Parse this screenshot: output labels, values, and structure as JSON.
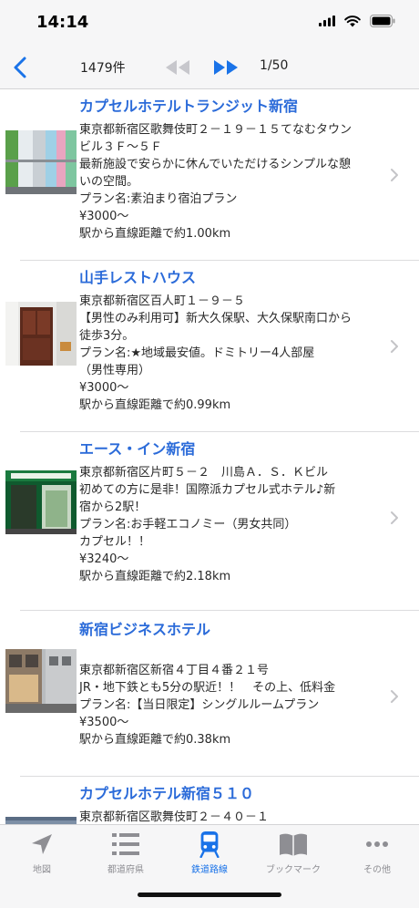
{
  "status": {
    "time": "14:14"
  },
  "nav": {
    "count": "1479件",
    "page": "1/50"
  },
  "hotels": [
    {
      "name": "カプセルホテルトランジット新宿",
      "lines": [
        "東京都新宿区歌舞伎町２－１９－１５てなむタウン",
        "ビル３Ｆ～５Ｆ",
        "最新施設で安らかに休んでいただけるシンプルな憩",
        "いの空間。",
        "プラン名:素泊まり宿泊プラン",
        "¥3000～",
        "駅から直線距離で約1.00km"
      ]
    },
    {
      "name": "山手レストハウス",
      "lines": [
        "東京都新宿区百人町１－９－５",
        "【男性のみ利用可】新大久保駅、大久保駅南口から",
        "徒歩3分。",
        "プラン名:★地域最安値。ドミトリー4人部屋",
        "（男性専用）",
        "¥3000～",
        "駅から直線距離で約0.99km"
      ]
    },
    {
      "name": "エース・イン新宿",
      "lines": [
        "東京都新宿区片町５－２　川島Ａ．Ｓ．Ｋビル",
        "初めての方に是非！国際派カプセル式ホテル♪新",
        "宿から2駅！",
        "プラン名:お手軽エコノミー（男女共同）",
        "カプセル！！",
        "¥3240～",
        "駅から直線距離で約2.18km"
      ]
    },
    {
      "name": "新宿ビジネスホテル",
      "lines": [
        "東京都新宿区新宿４丁目４番２１号",
        "JR・地下鉄とも5分の駅近！！　その上、低料金",
        "プラン名:【当日限定】シングルルームプラン",
        "¥3500～",
        "駅から直線距離で約0.38km"
      ]
    },
    {
      "name": "カプセルホテル新宿５１０",
      "lines": [
        "東京都新宿区歌舞伎町２－４０－１"
      ]
    }
  ],
  "tabs": [
    {
      "label": "地図",
      "icon": "location-arrow-icon",
      "active": false
    },
    {
      "label": "都道府県",
      "icon": "list-icon",
      "active": false
    },
    {
      "label": "鉄道路線",
      "icon": "train-icon",
      "active": true
    },
    {
      "label": "ブックマーク",
      "icon": "book-icon",
      "active": false
    },
    {
      "label": "その他",
      "icon": "more-icon",
      "active": false
    }
  ],
  "colors": {
    "accent": "#1a73e8",
    "title": "#2b6bd9",
    "inactive": "#8e8e93"
  }
}
